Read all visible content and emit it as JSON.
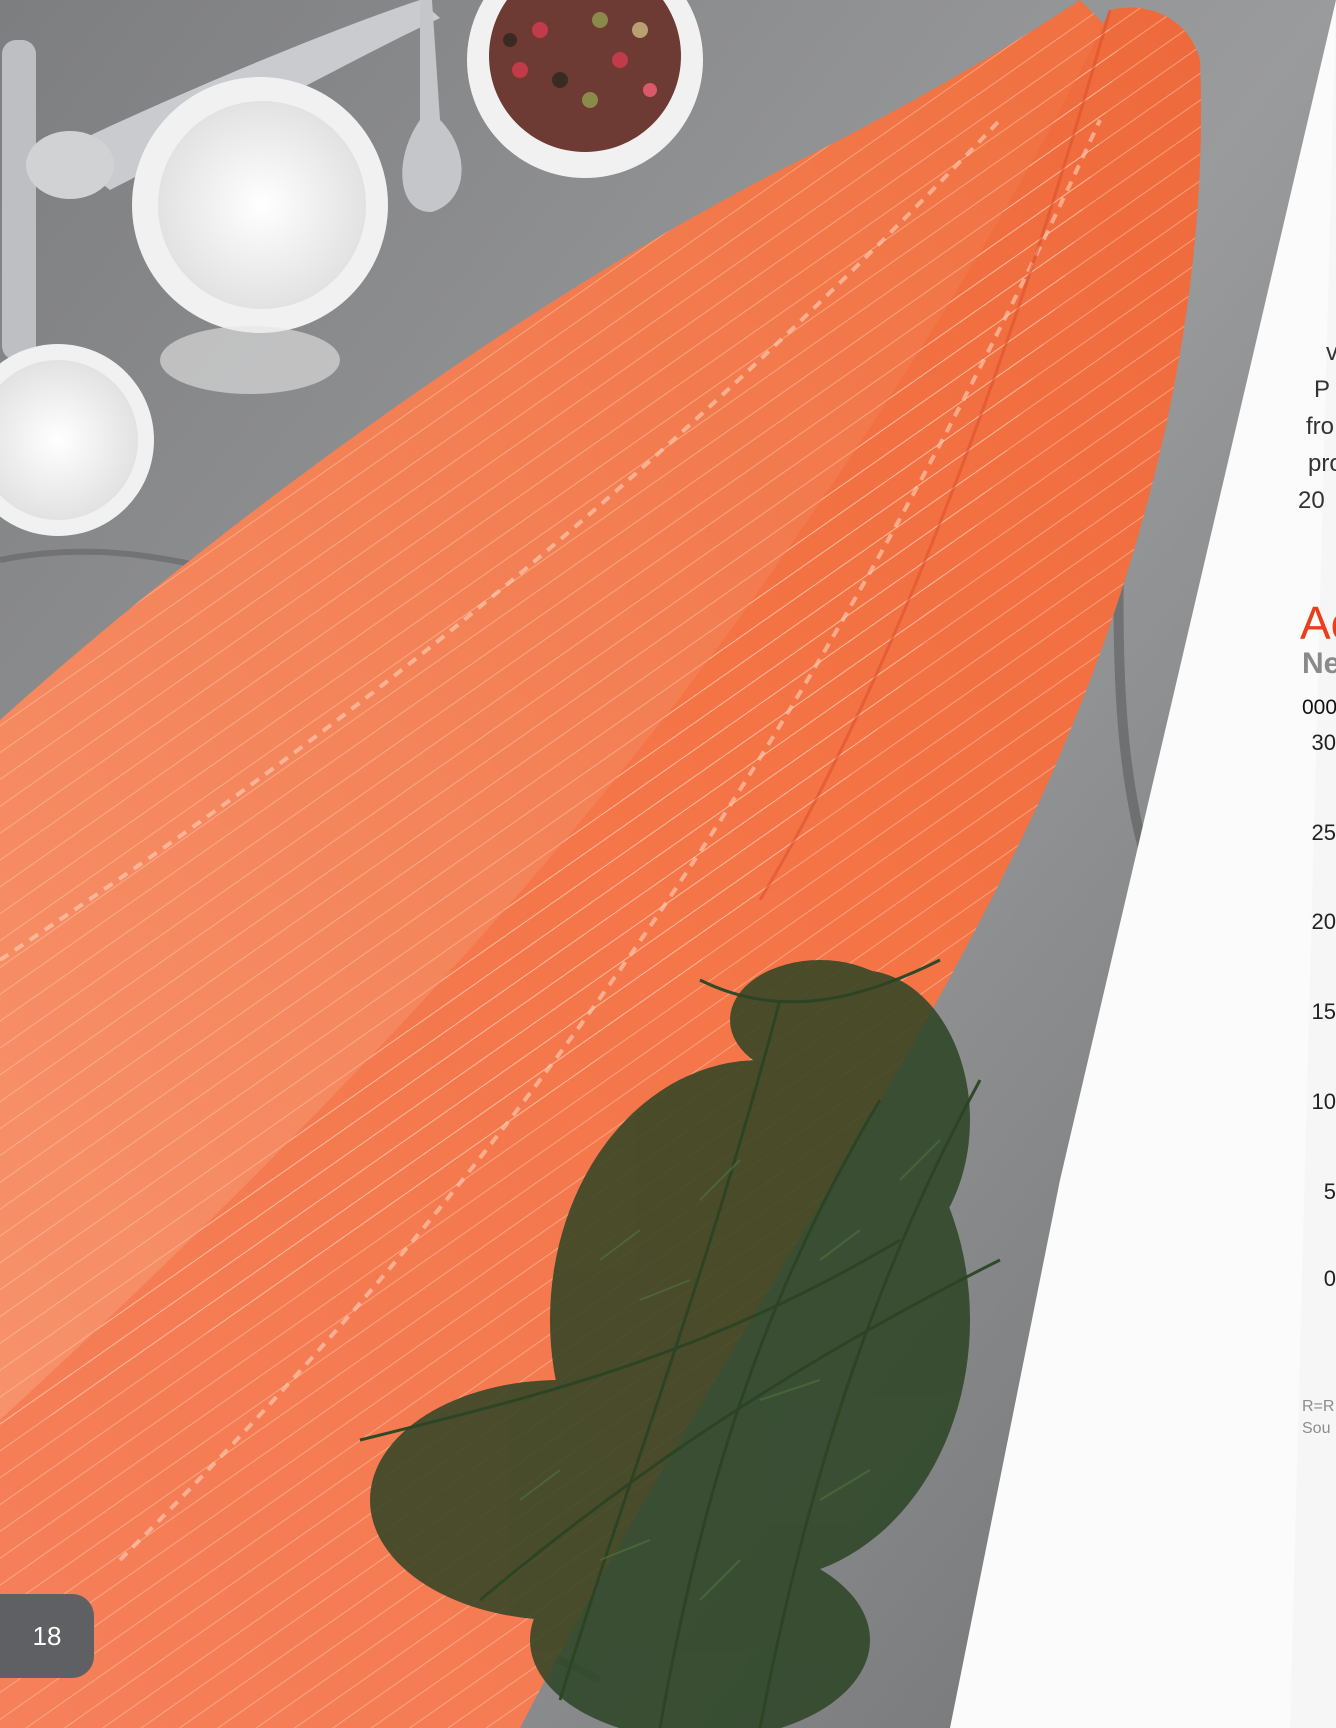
{
  "page_number": "18",
  "body_text_lines": [
    "v",
    "P",
    "fro",
    "pro",
    "20"
  ],
  "chart": {
    "title": "Ac",
    "subtitle": "Ne",
    "unit": "000",
    "y_ticks": [
      "30",
      "25",
      "20",
      "15",
      "10",
      "5",
      "0"
    ]
  },
  "footnote_lines": [
    "R=R",
    "Sou"
  ],
  "colors": {
    "accent_red": "#e8401c",
    "badge_gray": "#5e6063",
    "salmon": "#f07a50",
    "dill": "#2f4a26"
  }
}
